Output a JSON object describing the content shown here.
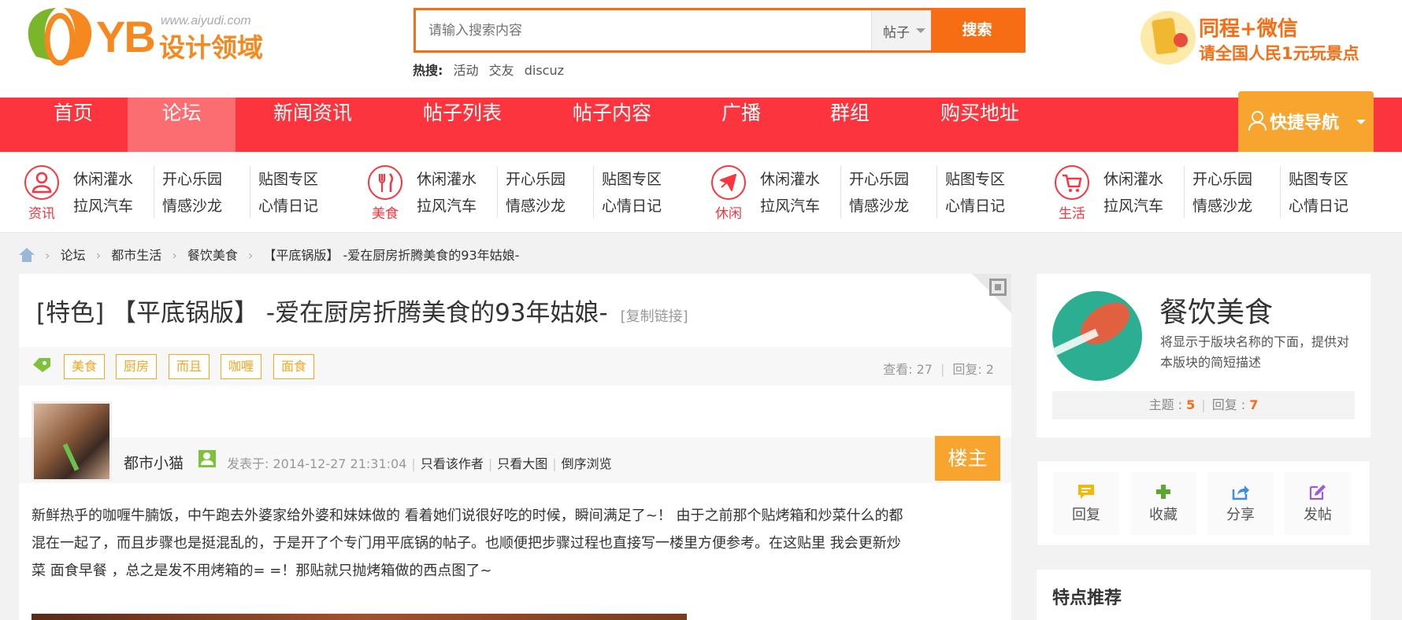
{
  "logo": {
    "brand": "YB",
    "url": "www.aiyudi.com",
    "cn": "设计领域"
  },
  "search": {
    "placeholder": "请输入搜索内容",
    "scope": "帖子",
    "button": "搜索"
  },
  "hot": {
    "label": "热搜:",
    "terms": [
      "活动",
      "交友",
      "discuz"
    ]
  },
  "promo": {
    "line1": "同程+微信",
    "line2": "请全国人民1元玩景点"
  },
  "nav": {
    "items": [
      "首页",
      "论坛",
      "新闻资讯",
      "帖子列表",
      "帖子内容",
      "广播",
      "群组",
      "购买地址"
    ],
    "active": "论坛",
    "quick": "快捷导航"
  },
  "subnav": [
    {
      "caption": "资讯",
      "icon": "person-icon",
      "links": [
        [
          "休闲灌水",
          "拉风汽车"
        ],
        [
          "开心乐园",
          "情感沙龙"
        ],
        [
          "贴图专区",
          "心情日记"
        ]
      ]
    },
    {
      "caption": "美食",
      "icon": "utensils-icon",
      "links": [
        [
          "休闲灌水",
          "拉风汽车"
        ],
        [
          "开心乐园",
          "情感沙龙"
        ],
        [
          "贴图专区",
          "心情日记"
        ]
      ]
    },
    {
      "caption": "休闲",
      "icon": "plane-icon",
      "links": [
        [
          "休闲灌水",
          "拉风汽车"
        ],
        [
          "开心乐园",
          "情感沙龙"
        ],
        [
          "贴图专区",
          "心情日记"
        ]
      ]
    },
    {
      "caption": "生活",
      "icon": "cart-icon",
      "links": [
        [
          "休闲灌水",
          "拉风汽车"
        ],
        [
          "开心乐园",
          "情感沙龙"
        ],
        [
          "贴图专区",
          "心情日记"
        ]
      ]
    }
  ],
  "breadcrumb": [
    "论坛",
    "都市生活",
    "餐饮美食",
    "【平底锅版】 -爱在厨房折腾美食的93年姑娘-"
  ],
  "post": {
    "title": "[特色] 【平底锅版】 -爱在厨房折腾美食的93年姑娘-",
    "copy_link": "[复制链接]",
    "tags": [
      "美食",
      "厨房",
      "而且",
      "咖喱",
      "面食"
    ],
    "views_label": "查看: 27",
    "replies_label": "回复: 2",
    "author": "都市小猫",
    "posted": "发表于: 2014-12-27 21:31:04",
    "links": [
      "只看该作者",
      "只看大图",
      "倒序浏览"
    ],
    "floor": "楼主",
    "body": [
      "新鲜热乎的咖喱牛腩饭，中午跑去外婆家给外婆和妹妹做的 看着她们说很好吃的时候，瞬间满足了~！ 由于之前那个贴烤箱和炒菜什么的都",
      "混在一起了，而且步骤也是挺混乱的，于是开了个专门用平底锅的帖子。也顺便把步骤过程也直接写一楼里方便参考。在这贴里 我会更新炒",
      "菜 面食早餐  ，总之是发不用烤箱的= =！那贴就只抛烤箱做的西点图了~"
    ]
  },
  "forum": {
    "name": "餐饮美食",
    "desc": "将显示于版块名称的下面，提供对本版块的简短描述",
    "topics_label": "主题 :",
    "topics": "5",
    "replies_label": "回复 :",
    "replies": "7"
  },
  "actions": [
    {
      "label": "回复",
      "icon": "comment-icon",
      "color": "#f5b800"
    },
    {
      "label": "收藏",
      "icon": "plus-icon",
      "color": "#5aa832"
    },
    {
      "label": "分享",
      "icon": "share-icon",
      "color": "#3a8ee6"
    },
    {
      "label": "发帖",
      "icon": "edit-icon",
      "color": "#a259d9"
    }
  ],
  "recommend_title": "特点推荐",
  "colors": {
    "nav": "#fc343d",
    "accent": "#f76d14",
    "quick": "#f8a52f"
  }
}
